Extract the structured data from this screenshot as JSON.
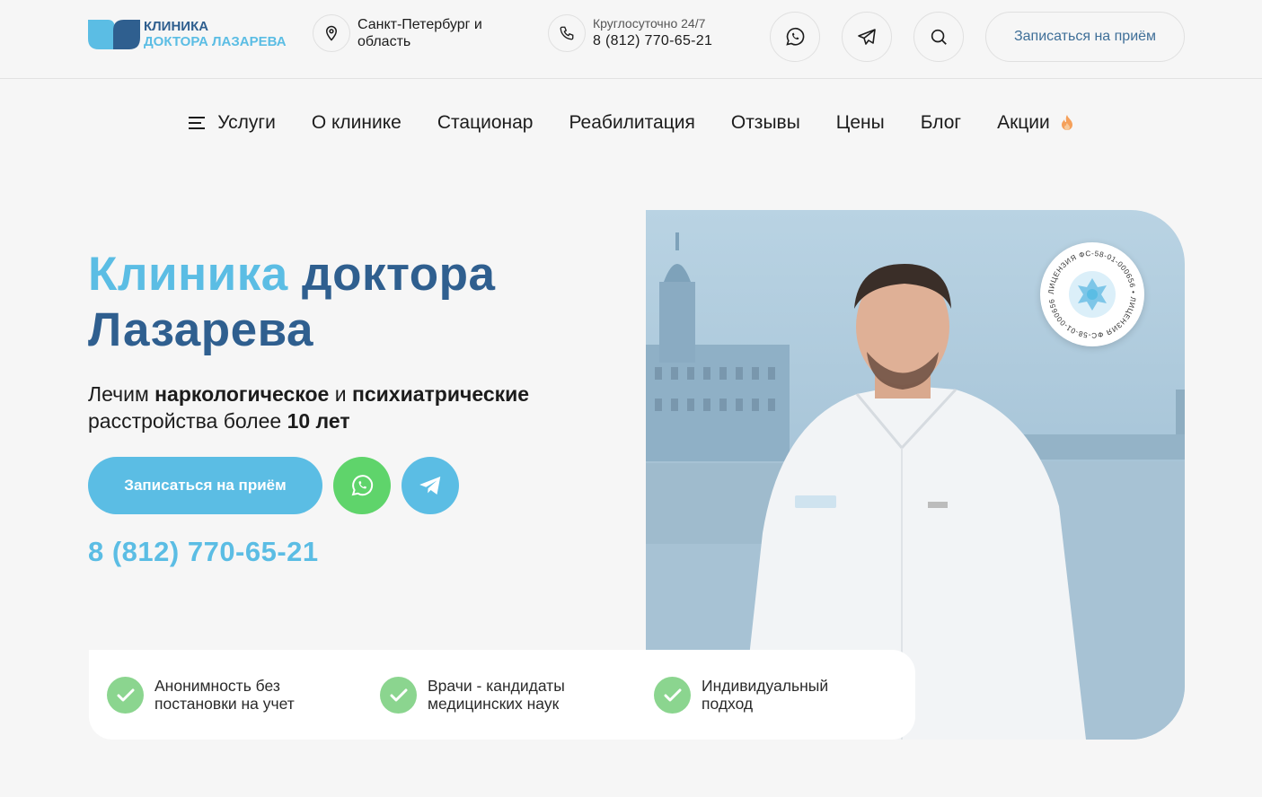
{
  "header": {
    "logo": {
      "line1": "Клиника",
      "line2": "доктора Лазарева",
      "brand_dark": "#2f5f8f",
      "brand_light": "#5bbde4"
    },
    "location": {
      "icon": "map-pin-icon",
      "text": "Санкт-Петербург и область"
    },
    "phone": {
      "icon": "phone-icon",
      "label": "Круглосуточно 24/7",
      "number": "8 (812) 770-65-21"
    },
    "icon_buttons": [
      "whatsapp-icon",
      "telegram-icon",
      "search-icon"
    ],
    "book_label": "Записаться на приём"
  },
  "nav": {
    "items": [
      {
        "label": "Услуги",
        "icon": "menu-icon"
      },
      {
        "label": "О клинике"
      },
      {
        "label": "Стационар"
      },
      {
        "label": "Реабилитация"
      },
      {
        "label": "Отзывы"
      },
      {
        "label": "Цены"
      },
      {
        "label": "Блог"
      },
      {
        "label": "Акции",
        "icon": "fire-icon"
      }
    ]
  },
  "hero": {
    "title_accent": "Клиника",
    "title_rest_1": "доктора",
    "title_rest_2": "Лазарева",
    "sub": {
      "p1": "Лечим ",
      "b1": "наркологическое",
      "p2": " и ",
      "b2": "психиатрические",
      "p3": " расстройства более ",
      "b3": "10 лет"
    },
    "cta_label": "Записаться на приём",
    "phone": "8 (812) 770-65-21",
    "whatsapp_color": "#5fd46b",
    "telegram_color": "#5bbde4"
  },
  "badge": {
    "text": "ЛИЦЕНЗИЯ ФС-58-01-000656 • ЛИЦЕНЗИЯ ФС-58-01-000656 •"
  },
  "features": [
    {
      "text": "Анонимность без постановки на учет"
    },
    {
      "text": "Врачи - кандидаты медицинских наук"
    },
    {
      "text": "Индивидуальный подход"
    }
  ]
}
